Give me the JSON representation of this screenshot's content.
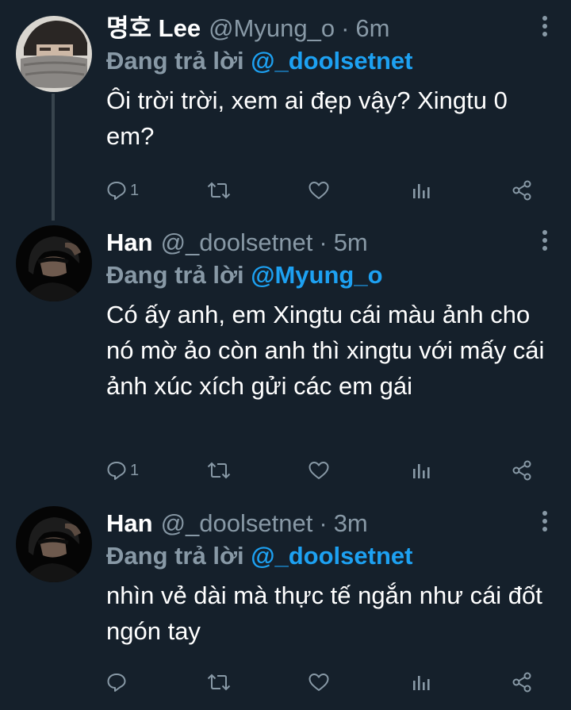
{
  "tweets": [
    {
      "name": "명호 Lee",
      "handle": "@Myung_o",
      "sep": "·",
      "time": "6m",
      "reply_prefix": "Đang trả lời",
      "reply_to": "@_doolsetnet",
      "text": "Ôi trời trời, xem ai đẹp vậy? Xingtu 0 em?",
      "reply_count": "1"
    },
    {
      "name": "Han",
      "handle": "@_doolsetnet",
      "sep": "·",
      "time": "5m",
      "reply_prefix": "Đang trả lời",
      "reply_to": "@Myung_o",
      "text": "Có ấy anh, em Xingtu cái màu ảnh cho nó mờ ảo còn anh thì xingtu với mấy cái ảnh xúc xích gửi các em gái",
      "reply_count": "1"
    },
    {
      "name": "Han",
      "handle": "@_doolsetnet",
      "sep": "·",
      "time": "3m",
      "reply_prefix": "Đang trả lời",
      "reply_to": "@_doolsetnet",
      "text": "nhìn vẻ dài mà thực tế ngắn như cái đốt ngón tay",
      "reply_count": ""
    }
  ],
  "colors": {
    "background": "#15202b",
    "muted": "#8899a6",
    "accent": "#1da1f2",
    "thread_line": "#38444d"
  },
  "icons": [
    "reply-icon",
    "retweet-icon",
    "like-icon",
    "analytics-icon",
    "share-icon",
    "more-icon"
  ]
}
